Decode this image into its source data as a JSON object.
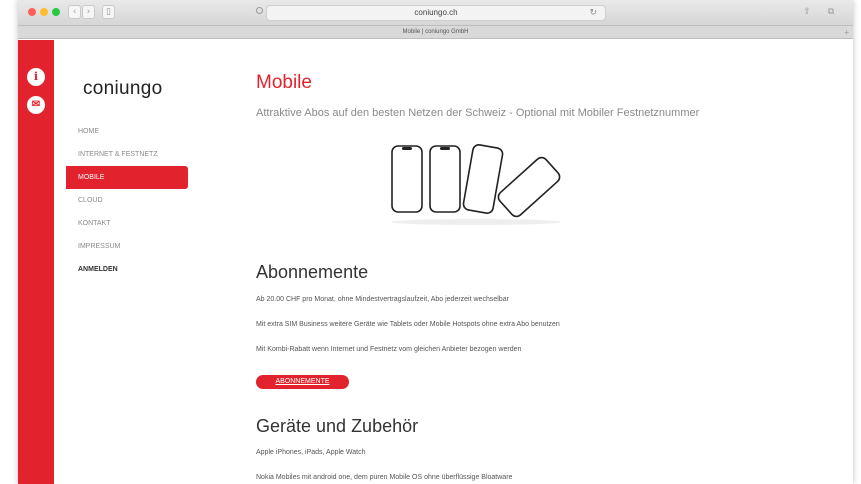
{
  "browser": {
    "url": "coniungo.ch",
    "tab_title": "Mobile | coniungo GmbH",
    "nav_back": "‹",
    "nav_forward": "›",
    "sidebar_toggle": "▯",
    "reload": "↻",
    "share": "⇪",
    "tabs": "⧉",
    "new_tab": "+"
  },
  "sidebar_icons": {
    "info": "i",
    "mail": "✉"
  },
  "logo": "coniungo",
  "nav": {
    "items": [
      {
        "label": "HOME"
      },
      {
        "label": "INTERNET & FESTNETZ"
      },
      {
        "label": "MOBILE"
      },
      {
        "label": "CLOUD"
      },
      {
        "label": "KONTAKT"
      },
      {
        "label": "IMPRESSUM"
      },
      {
        "label": "ANMELDEN"
      }
    ]
  },
  "main": {
    "title": "Mobile",
    "subtitle": "Attraktive Abos auf den besten Netzen der Schweiz - Optional mit Mobiler Festnetznummer",
    "abonnemente": {
      "heading": "Abonnemente",
      "lines": [
        "Ab 20.00 CHF pro Monat, ohne Mindestvertragslaufzeit, Abo jederzeit wechselbar",
        "Mit extra SIM Business weitere Geräte wie Tablets oder Mobile Hotspots ohne extra Abo benutzen",
        "Mit Kombi-Rabatt wenn Internet und Festnetz vom gleichen Anbieter bezogen werden"
      ],
      "button": "ABONNEMENTE"
    },
    "geraete": {
      "heading": "Geräte und Zubehör",
      "lines": [
        "Apple iPhones, iPads, Apple Watch",
        "Nokia Mobiles mit android one, dem puren Mobile OS ohne überflüssige Bloatware"
      ]
    }
  },
  "colors": {
    "accent": "#e2232d"
  }
}
